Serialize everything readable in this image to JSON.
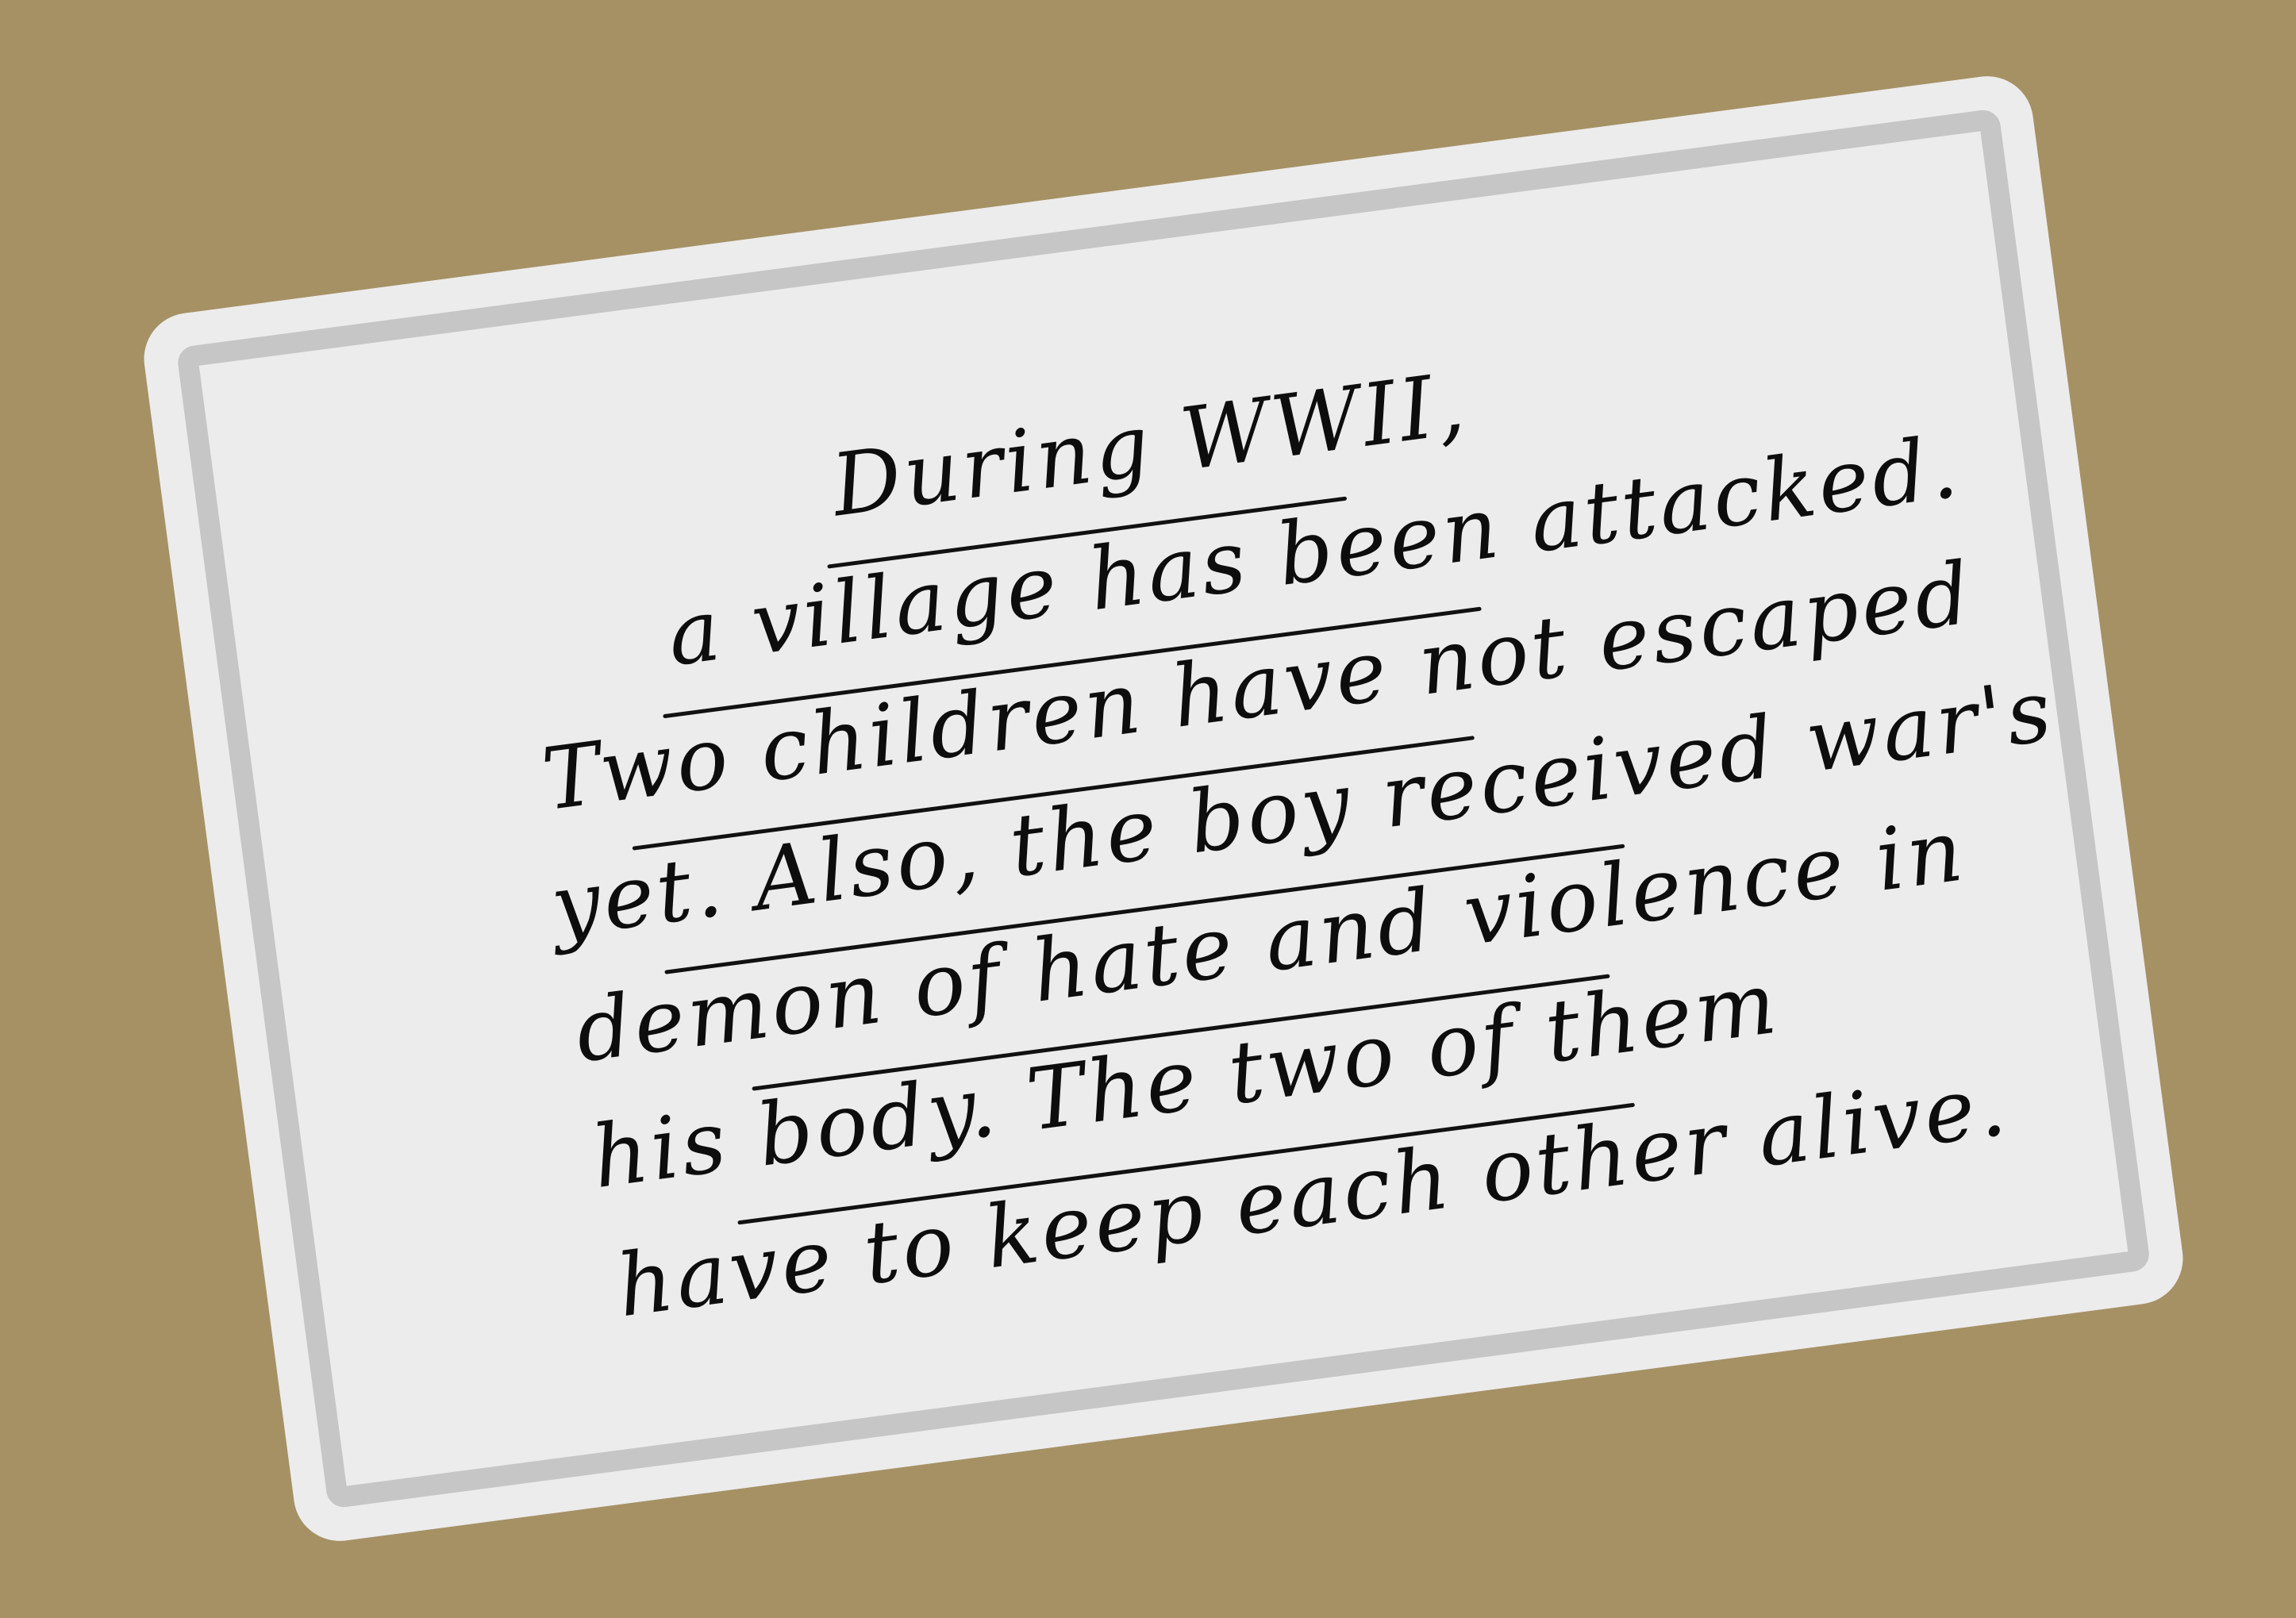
{
  "background_color": "#a69165",
  "card": {
    "fill_color": "#ececec",
    "frame_color": "#c6c6c6",
    "ink_color": "#0d0d0d"
  },
  "note": {
    "lines": [
      "During WWII,",
      "a village has been attacked.",
      "Two children have not escaped",
      "yet. Also, the boy received war's",
      "demon of hate and violence in",
      "his body. The two of them",
      "have to keep each other alive."
    ]
  }
}
